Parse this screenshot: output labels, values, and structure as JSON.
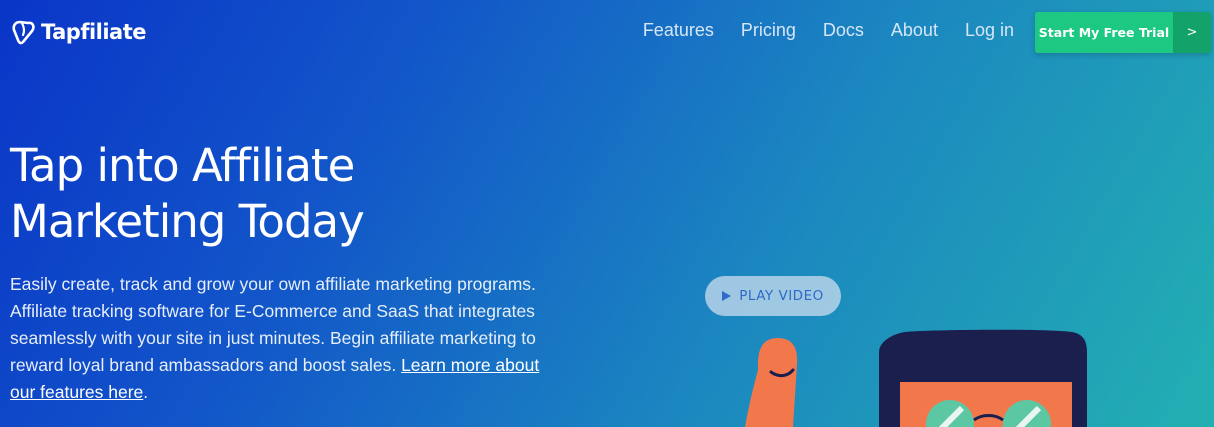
{
  "header": {
    "logo_text": "Tapfiliate",
    "nav": [
      {
        "label": "Features"
      },
      {
        "label": "Pricing"
      },
      {
        "label": "Docs"
      },
      {
        "label": "About"
      },
      {
        "label": "Log in"
      }
    ],
    "cta_label": "Start My Free Trial",
    "cta_arrow": ">"
  },
  "hero": {
    "title_line1": "Tap into Affiliate",
    "title_line2": "Marketing Today",
    "description": "Easily create, track and grow your own affiliate marketing programs. Affiliate tracking software for E-Commerce and SaaS that integrates seamlessly with your site in just minutes. Begin affiliate marketing to reward loyal brand ambassadors and boost sales.",
    "link_text": "Learn more about our features here",
    "link_suffix": ".",
    "play_label": "PLAY VIDEO"
  },
  "colors": {
    "cta_green": "#1cc882",
    "cta_green_dark": "#12a26a",
    "gradient_start": "#0a35c8",
    "gradient_end": "#23b0b2",
    "illustration_orange": "#f2784b",
    "illustration_navy": "#1a1f4e",
    "illustration_mint": "#5cc7a3"
  },
  "icons": {
    "logo": "tapfiliate-logo-icon",
    "play": "play-icon"
  }
}
